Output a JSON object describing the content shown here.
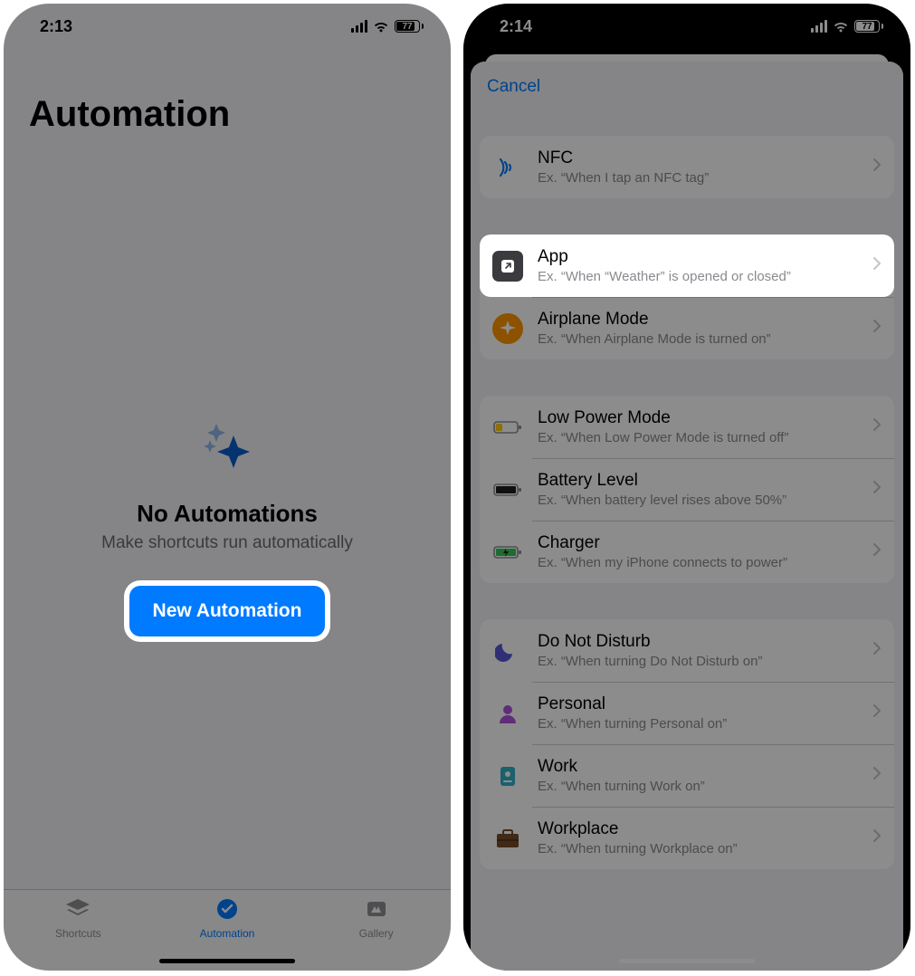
{
  "left": {
    "status": {
      "time": "2:13",
      "battery": "77"
    },
    "title": "Automation",
    "empty": {
      "heading": "No Automations",
      "subtitle": "Make shortcuts run automatically",
      "button": "New Automation"
    },
    "tabs": {
      "shortcuts": "Shortcuts",
      "automation": "Automation",
      "gallery": "Gallery"
    }
  },
  "right": {
    "status": {
      "time": "2:14",
      "battery": "77"
    },
    "cancel": "Cancel",
    "triggers": {
      "nfc": {
        "title": "NFC",
        "sub": "Ex. “When I tap an NFC tag”"
      },
      "app": {
        "title": "App",
        "sub": "Ex. “When “Weather” is opened or closed”"
      },
      "airplane": {
        "title": "Airplane Mode",
        "sub": "Ex. “When Airplane Mode is turned on”"
      },
      "lowpower": {
        "title": "Low Power Mode",
        "sub": "Ex. “When Low Power Mode is turned off”"
      },
      "battery": {
        "title": "Battery Level",
        "sub": "Ex. “When battery level rises above 50%”"
      },
      "charger": {
        "title": "Charger",
        "sub": "Ex. “When my iPhone connects to power”"
      },
      "dnd": {
        "title": "Do Not Disturb",
        "sub": "Ex. “When turning Do Not Disturb on”"
      },
      "personal": {
        "title": "Personal",
        "sub": "Ex. “When turning Personal on”"
      },
      "work": {
        "title": "Work",
        "sub": "Ex. “When turning Work on”"
      },
      "workplace": {
        "title": "Workplace",
        "sub": "Ex. “When turning Workplace on”"
      }
    }
  }
}
